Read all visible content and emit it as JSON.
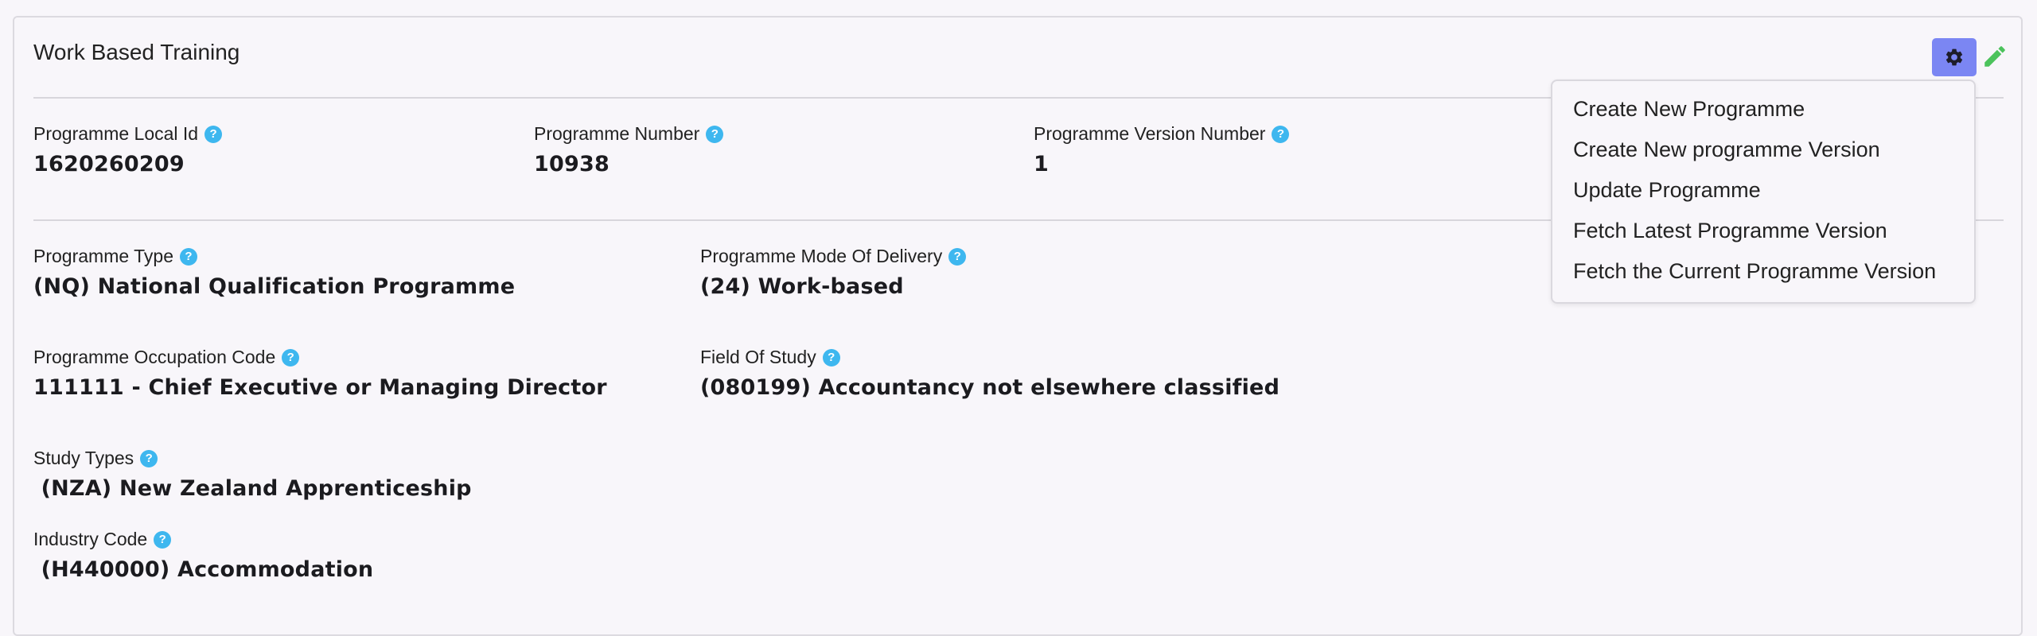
{
  "card": {
    "title": "Work Based Training"
  },
  "fields": {
    "local_id": {
      "label": "Programme Local Id",
      "value": "1620260209"
    },
    "number": {
      "label": "Programme Number",
      "value": "10938"
    },
    "version": {
      "label": "Programme Version Number",
      "value": "1"
    },
    "type": {
      "label": "Programme Type",
      "value": "(NQ) National Qualification Programme"
    },
    "mode": {
      "label": "Programme Mode Of Delivery",
      "value": "(24) Work-based"
    },
    "occupation": {
      "label": "Programme Occupation Code",
      "value": "111111 - Chief Executive or Managing Director"
    },
    "field_of_study": {
      "label": "Field Of Study",
      "value": "(080199) Accountancy not elsewhere classified"
    },
    "study_types": {
      "label": "Study Types",
      "value": " (NZA) New Zealand Apprenticeship"
    },
    "industry": {
      "label": "Industry Code",
      "value": " (H440000) Accommodation"
    }
  },
  "help_glyph": "?",
  "menu": {
    "items": [
      "Create New Programme",
      "Create New programme Version",
      "Update Programme",
      "Fetch Latest Programme Version",
      "Fetch the Current Programme Version"
    ]
  },
  "colors": {
    "accent": "#7b86f3",
    "help": "#3eb7ef",
    "edit": "#4cc35c"
  },
  "icons": {
    "settings": "gear-icon",
    "edit": "pencil-icon",
    "help": "help-icon"
  }
}
